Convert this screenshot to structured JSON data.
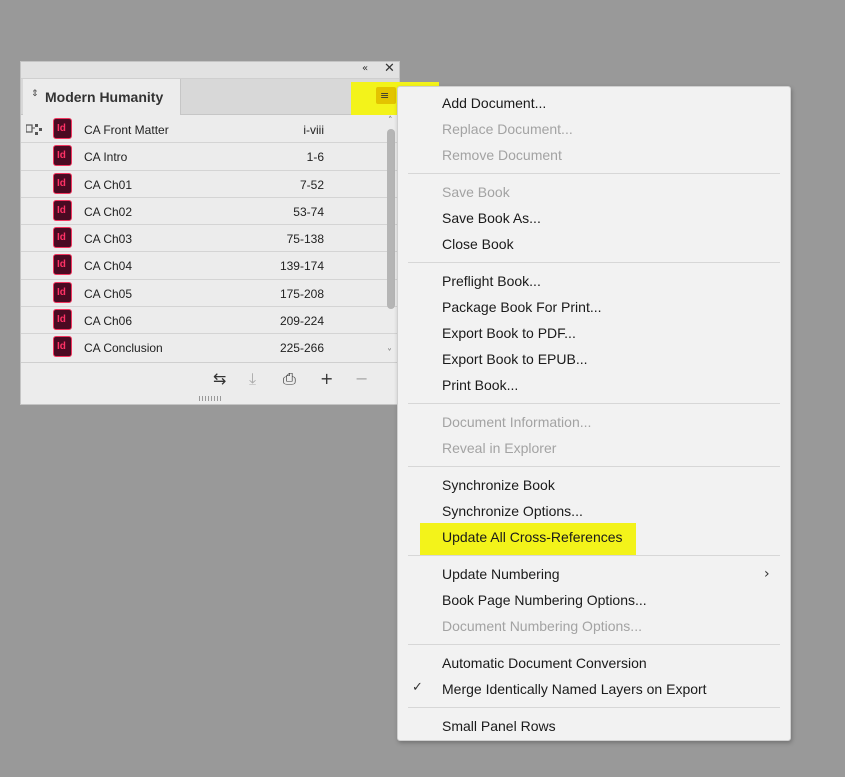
{
  "panel": {
    "tab_title": "Modern Humanity",
    "tab_arrows_icon": "⇕",
    "collapse_icon": "«",
    "close_icon": "✕",
    "menu_icon": "≡",
    "documents": [
      {
        "name": "CA Front Matter",
        "pages": "i-viii"
      },
      {
        "name": "CA Intro",
        "pages": "1-6"
      },
      {
        "name": "CA Ch01",
        "pages": "7-52"
      },
      {
        "name": "CA Ch02",
        "pages": "53-74"
      },
      {
        "name": "CA Ch03",
        "pages": "75-138"
      },
      {
        "name": "CA Ch04",
        "pages": "139-174"
      },
      {
        "name": "CA Ch05",
        "pages": "175-208"
      },
      {
        "name": "CA Ch06",
        "pages": "209-224"
      },
      {
        "name": "CA Conclusion",
        "pages": "225-266"
      }
    ],
    "doc_icon_label": "Id",
    "footer_icons": {
      "sync": "⇆",
      "save": "⤓",
      "print": "⎙",
      "add": "+",
      "remove": "−"
    },
    "scroll_up": "˄",
    "scroll_down": "˅"
  },
  "menu": {
    "items": {
      "add_document": "Add Document...",
      "replace_document": "Replace Document...",
      "remove_document": "Remove Document",
      "save_book": "Save Book",
      "save_book_as": "Save Book As...",
      "close_book": "Close Book",
      "preflight_book": "Preflight Book...",
      "package_book": "Package Book For Print...",
      "export_pdf": "Export Book to PDF...",
      "export_epub": "Export Book to EPUB...",
      "print_book": "Print Book...",
      "document_information": "Document Information...",
      "reveal_in_explorer": "Reveal in Explorer",
      "synchronize_book": "Synchronize Book",
      "synchronize_options": "Synchronize Options...",
      "update_xrefs": "Update All Cross-References",
      "update_numbering": "Update Numbering",
      "book_page_numbering": "Book Page Numbering Options...",
      "document_numbering": "Document Numbering Options...",
      "auto_doc_conversion": "Automatic Document Conversion",
      "merge_layers": "Merge Identically Named Layers on Export",
      "small_panel_rows": "Small Panel Rows"
    },
    "submenu_arrow": "›",
    "checkmark": "✓"
  },
  "colors": {
    "highlight": "#f3f31a",
    "indesign_icon_bg": "#4a0a22",
    "indesign_icon_fg": "#ff3366",
    "disabled_text": "#a3a3a3"
  }
}
